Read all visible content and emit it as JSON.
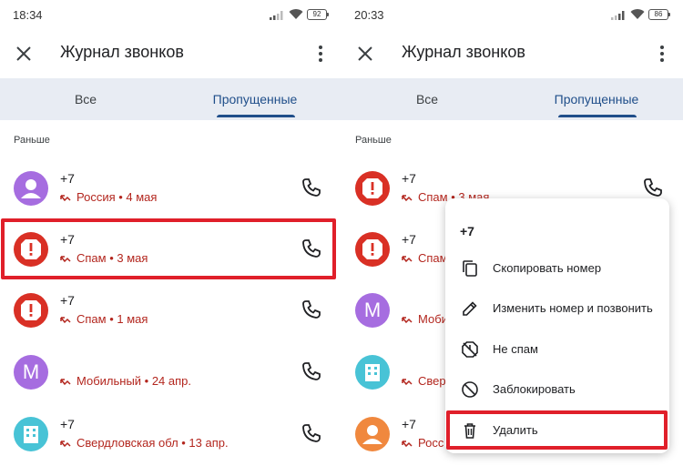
{
  "left": {
    "status": {
      "time": "18:34",
      "battery": "92"
    },
    "appbar": {
      "title": "Журнал звонков"
    },
    "tabs": {
      "all": "Все",
      "missed": "Пропущенные"
    },
    "section": "Раньше",
    "calls": [
      {
        "number": "+7",
        "sub": "Россия • 4 мая",
        "avatar": "person",
        "color": "#a66de0"
      },
      {
        "number": "+7",
        "sub": "Спам • 3 мая",
        "avatar": "spam",
        "color": "#d93025"
      },
      {
        "number": "+7",
        "sub": "Спам • 1 мая",
        "avatar": "spam",
        "color": "#d93025"
      },
      {
        "number": "",
        "sub": "Мобильный • 24 апр.",
        "avatar": "M",
        "color": "#a66de0"
      },
      {
        "number": "+7",
        "sub": "Свердловская обл • 13 апр.",
        "avatar": "building",
        "color": "#48c3d6"
      }
    ]
  },
  "right": {
    "status": {
      "time": "20:33",
      "battery": "86"
    },
    "appbar": {
      "title": "Журнал звонков"
    },
    "tabs": {
      "all": "Все",
      "missed": "Пропущенные"
    },
    "section": "Раньше",
    "calls": [
      {
        "number": "+7",
        "sub": "Спам • 3 мая",
        "avatar": "spam",
        "color": "#d93025"
      },
      {
        "number": "+7",
        "sub": "Спам",
        "avatar": "spam",
        "color": "#d93025"
      },
      {
        "number": "",
        "sub": "Моби",
        "avatar": "M",
        "color": "#a66de0"
      },
      {
        "number": "",
        "sub": "Свер",
        "avatar": "building",
        "color": "#48c3d6"
      },
      {
        "number": "+7",
        "sub": "Росс",
        "avatar": "person",
        "color": "#f0883e"
      }
    ],
    "menu": {
      "header": "+7",
      "items": [
        {
          "label": "Скопировать номер",
          "icon": "copy-icon"
        },
        {
          "label": "Изменить номер и позвонить",
          "icon": "edit-icon"
        },
        {
          "label": "Не спам",
          "icon": "not-spam-icon"
        },
        {
          "label": "Заблокировать",
          "icon": "block-icon"
        },
        {
          "label": "Удалить",
          "icon": "delete-icon"
        }
      ]
    }
  },
  "colors": {
    "accent": "#1f4e8a",
    "missed": "#b3261e",
    "highlight": "#e01f2a",
    "tab_bg": "#e8ecf3"
  }
}
